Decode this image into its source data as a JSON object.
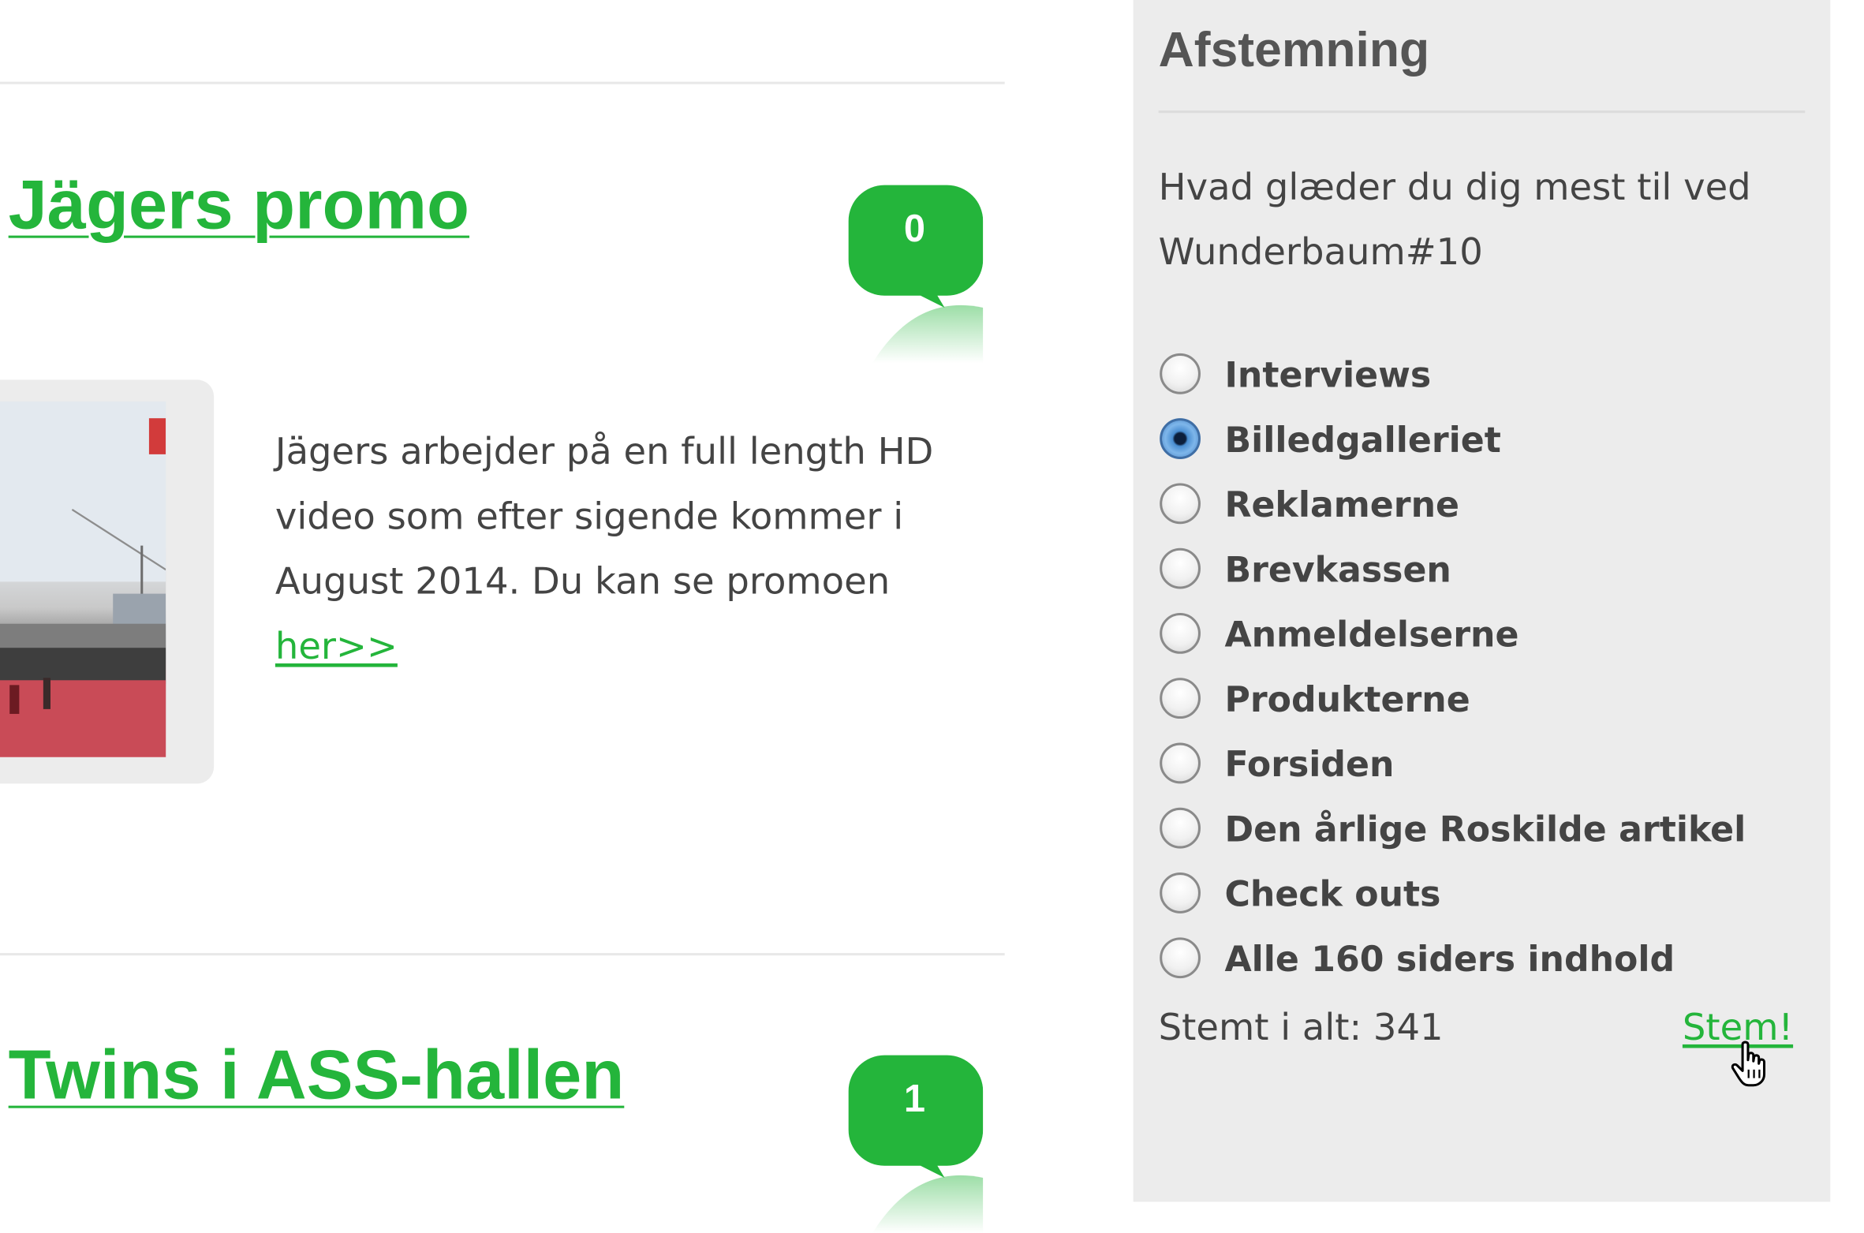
{
  "posts": [
    {
      "title": "Jägers promo",
      "comment_count": "0",
      "body": "Jägers arbejder på en full length HD video som efter sigende kommer i August 2014. Du kan se promoen ",
      "link": "her>>"
    },
    {
      "title": "Twins i ASS-hallen",
      "comment_count": "1"
    }
  ],
  "poll": {
    "title": "Afstemning",
    "question": "Hvad glæder du dig mest til ved Wunderbaum#10",
    "options": [
      "Interviews",
      "Billedgalleriet",
      "Reklamerne",
      "Brevkassen",
      "Anmeldelserne",
      "Produkterne",
      "Forsiden",
      "Den årlige Roskilde artikel",
      "Check outs",
      "Alle 160 siders indhold"
    ],
    "selected": "Billedgalleriet",
    "total_label": "Stemt i alt: 341",
    "vote_label": "Stem!"
  },
  "colors": {
    "accent_green": "#24b53b",
    "panel_bg": "#ececec",
    "text": "#444444"
  },
  "icons": {
    "comment": "speech-bubble-icon",
    "cursor": "hand-pointer-icon"
  }
}
